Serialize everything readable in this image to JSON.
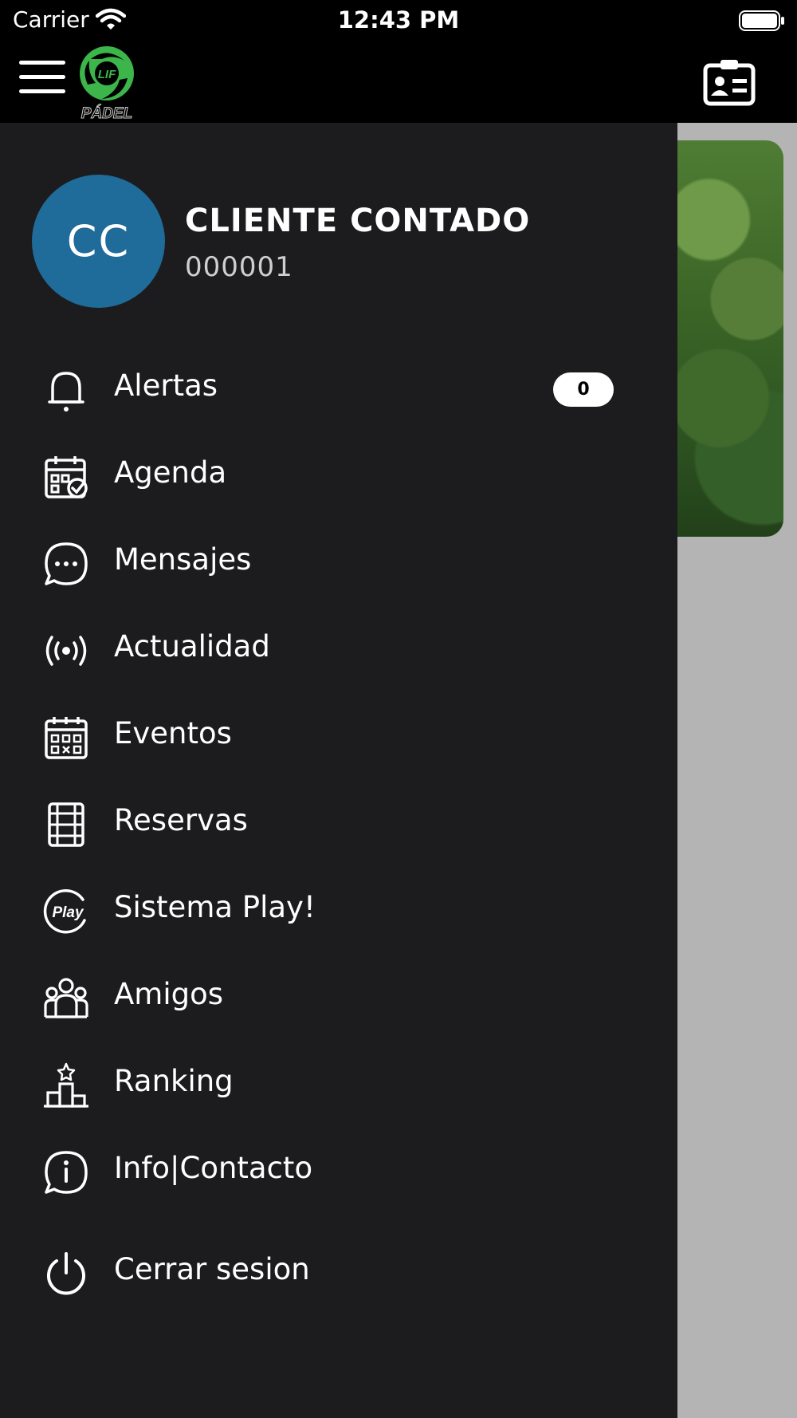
{
  "status_bar": {
    "carrier": "Carrier",
    "time": "12:43 PM"
  },
  "header": {
    "logo_text_top": "LIF",
    "logo_text_bottom": "PÁDEL"
  },
  "profile": {
    "initials": "CC",
    "name": "CLIENTE CONTADO",
    "id": "000001",
    "avatar_color": "#1f6b99"
  },
  "menu": {
    "items": [
      {
        "label": "Alertas",
        "icon": "bell-icon"
      },
      {
        "label": "Agenda",
        "icon": "calendar-check-icon"
      },
      {
        "label": "Mensajes",
        "icon": "chat-bubble-icon"
      },
      {
        "label": "Actualidad",
        "icon": "broadcast-icon"
      },
      {
        "label": "Eventos",
        "icon": "calendar-grid-icon"
      },
      {
        "label": "Reservas",
        "icon": "court-icon"
      },
      {
        "label": "Sistema Play!",
        "icon": "play-badge-icon"
      },
      {
        "label": "Amigos",
        "icon": "group-icon"
      },
      {
        "label": "Ranking",
        "icon": "podium-icon"
      },
      {
        "label": "Info|Contacto",
        "icon": "info-bubble-icon"
      },
      {
        "label": "Cerrar sesion",
        "icon": "power-icon"
      }
    ],
    "alerts_count": "0",
    "play_icon_text": "Play"
  },
  "colors": {
    "drawer_bg": "#1c1c1e",
    "header_bg": "#000000",
    "logo_green": "#3cb54a"
  }
}
